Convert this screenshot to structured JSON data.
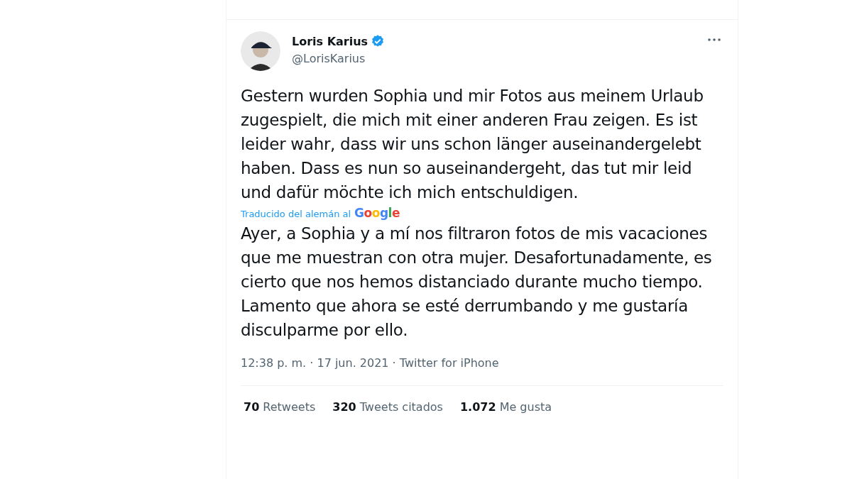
{
  "tweet": {
    "author": {
      "name": "Loris Karius",
      "verified": true,
      "handle": "@LorisKarius"
    },
    "text": "Gestern wurden Sophia und mir Fotos aus meinem Urlaub zugespielt, die mich mit einer anderen Frau zeigen. Es ist leider wahr, dass wir uns schon länger auseinandergelebt haben. Dass es nun so auseinandergeht, das tut mir leid und dafür möchte ich mich entschuldigen.",
    "translation_note": "Traducido del alemán al",
    "translation_provider": "Google",
    "translated_text": "Ayer, a Sophia y a mí nos filtraron fotos de mis vacaciones que me muestran con otra mujer. Desafortunadamente, es cierto que nos hemos distanciado durante mucho tiempo. Lamento que ahora se esté derrumbando y me gustaría disculparme por ello.",
    "timestamp": "12:38 p. m. · 17 jun. 2021 · Twitter for iPhone",
    "stats": [
      {
        "count": "70",
        "label": "Retweets"
      },
      {
        "count": "320",
        "label": "Tweets citados"
      },
      {
        "count": "1.072",
        "label": "Me gusta"
      }
    ]
  }
}
